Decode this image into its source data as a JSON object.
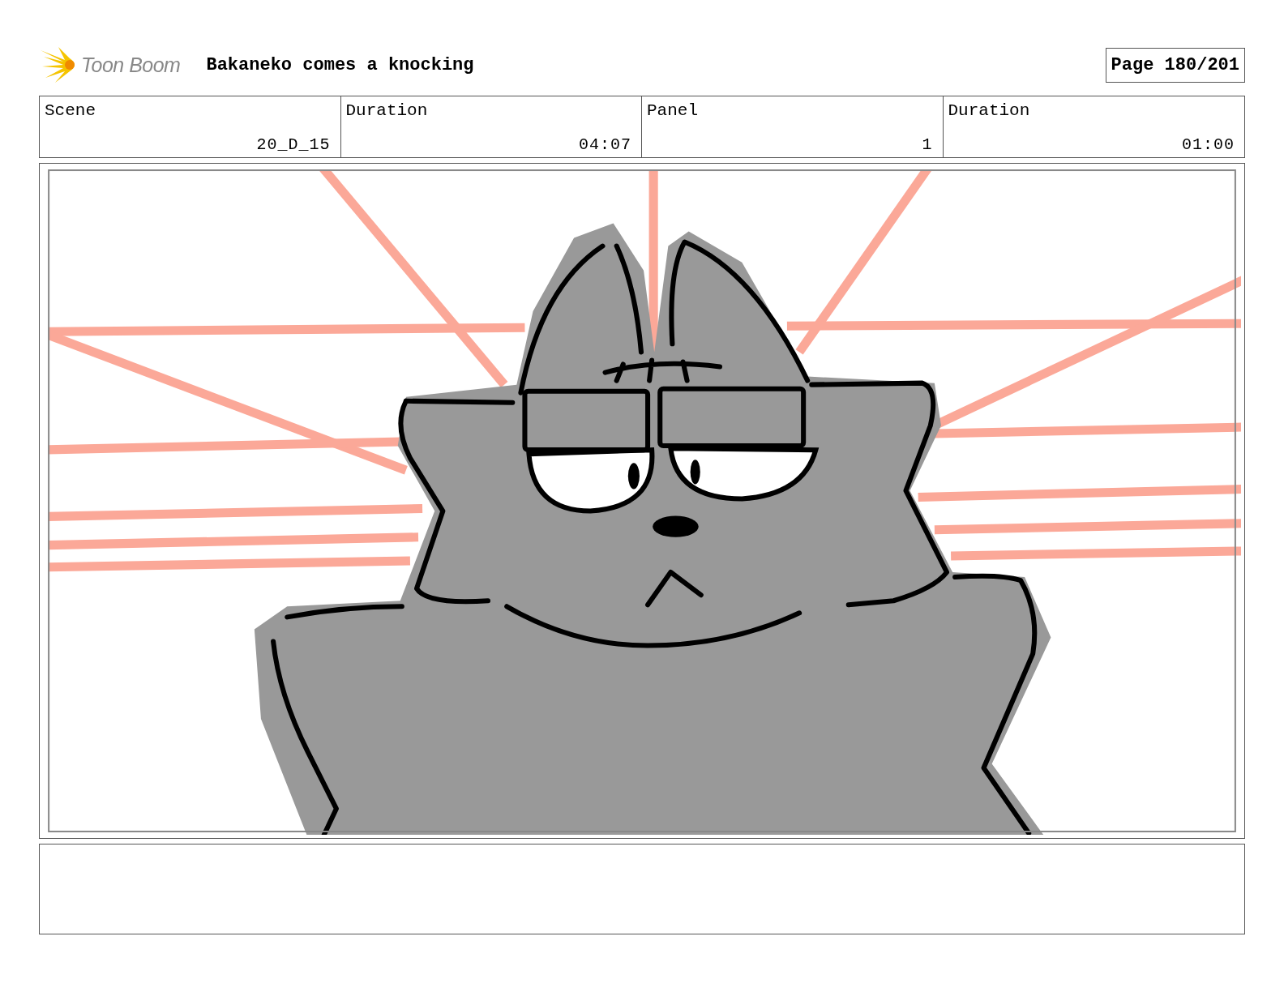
{
  "header": {
    "logo_text": "Toon Boom",
    "title": "Bakaneko comes a knocking",
    "page": "Page 180/201"
  },
  "info": [
    {
      "label": "Scene",
      "value": "20_D_15"
    },
    {
      "label": "Duration",
      "value": "04:07"
    },
    {
      "label": "Panel",
      "value": "1"
    },
    {
      "label": "Duration",
      "value": "01:00"
    }
  ]
}
